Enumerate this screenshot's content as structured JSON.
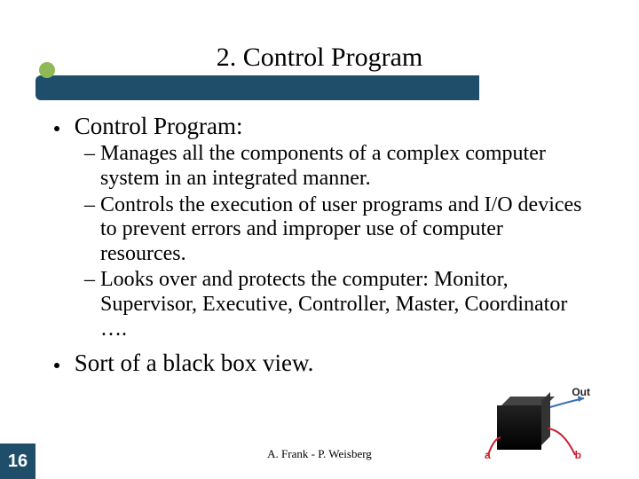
{
  "title": "2. Control Program",
  "bullets": {
    "b1": "Control Program:",
    "b1_sub1": "Manages all the components of a complex computer system in an integrated manner.",
    "b1_sub2": "Controls the execution of user programs and I/O devices to prevent errors and improper use of computer resources.",
    "b1_sub3": "Looks over and protects the computer: Monitor, Supervisor, Executive, Controller, Master, Coordinator ….",
    "b2": "Sort of a black box view."
  },
  "figure": {
    "out": "Out",
    "a": "a",
    "b": "b"
  },
  "footer": "A. Frank - P. Weisberg",
  "slide_number": "16"
}
